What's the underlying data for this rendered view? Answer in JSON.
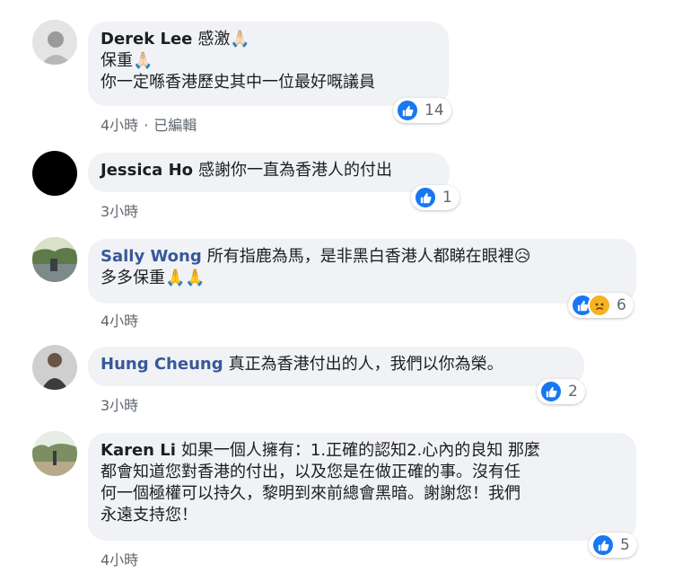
{
  "colors": {
    "like": "#1877f2",
    "sad": "#f7b125",
    "bubble": "#f0f2f5",
    "author_blue": "#385898"
  },
  "comments": [
    {
      "author": "Derek Lee",
      "lines": [
        "感激🙏🏻",
        "保重🙏🏻",
        "你一定喺香港歷史其中一位最好嘅議員"
      ],
      "time": "4小時",
      "edited": "已編輯",
      "reaction_count": "14",
      "reactions": [
        "like-icon"
      ]
    },
    {
      "author": "Jessica Ho",
      "lines": [
        "感謝你一直為香港人的付出"
      ],
      "time": "3小時",
      "reaction_count": "1",
      "reactions": [
        "like-icon"
      ]
    },
    {
      "author": "Sally Wong",
      "lines": [
        "所有指鹿為馬，是非黑白香港人都睇在眼裡😥",
        "多多保重🙏🙏"
      ],
      "time": "4小時",
      "reaction_count": "6",
      "reactions": [
        "like-icon",
        "sad-icon"
      ]
    },
    {
      "author": "Hung Cheung",
      "lines": [
        "真正為香港付出的人，我們以你為榮。"
      ],
      "time": "3小時",
      "reaction_count": "2",
      "reactions": [
        "like-icon"
      ]
    },
    {
      "author": "Karen Li",
      "lines": [
        "如果一個人擁有：1.正確的認知2.心內的良知 那麼",
        "都會知道您對香港的付出，以及您是在做正確的事。沒有任",
        "何一個極權可以持久，黎明到來前總會黑暗。謝謝您！我們",
        "永遠支持您！"
      ],
      "time": "4小時",
      "reaction_count": "5",
      "reactions": [
        "like-icon"
      ]
    }
  ]
}
